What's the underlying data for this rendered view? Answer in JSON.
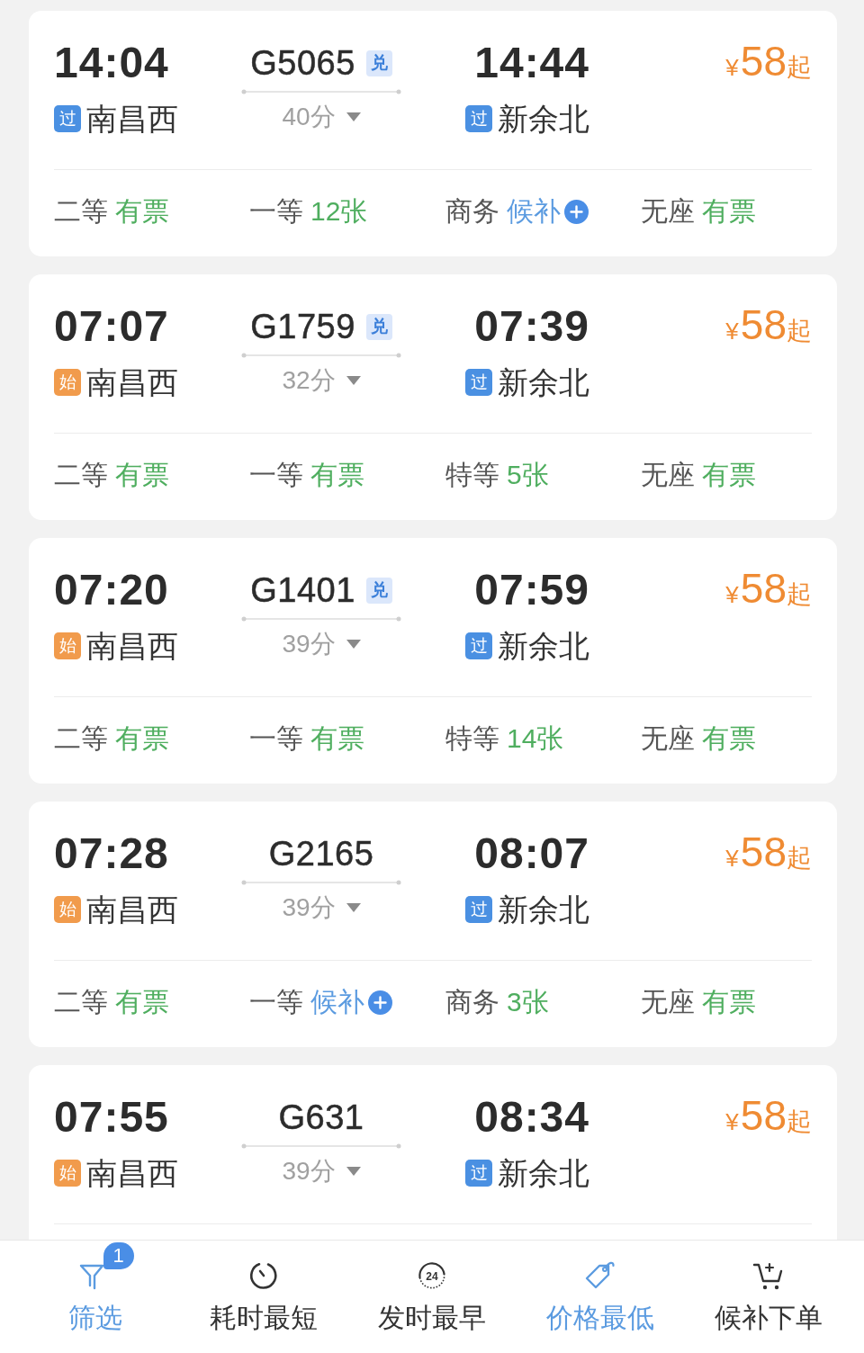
{
  "trains": [
    {
      "depart_time": "14:04",
      "from": {
        "tag": "过",
        "kind": "pass",
        "name": "南昌西"
      },
      "train_no": "G5065",
      "badge": "兑",
      "duration": "40分",
      "arrive_time": "14:44",
      "to": {
        "tag": "过",
        "kind": "pass",
        "name": "新余北"
      },
      "price": {
        "currency": "¥",
        "amount": "58",
        "suffix": "起"
      },
      "seats": [
        {
          "class": "二等",
          "status": "有票",
          "kind": "available"
        },
        {
          "class": "一等",
          "status": "12张",
          "kind": "available"
        },
        {
          "class": "商务",
          "status": "候补",
          "kind": "waitlist"
        },
        {
          "class": "无座",
          "status": "有票",
          "kind": "available"
        }
      ]
    },
    {
      "depart_time": "07:07",
      "from": {
        "tag": "始",
        "kind": "origin",
        "name": "南昌西"
      },
      "train_no": "G1759",
      "badge": "兑",
      "duration": "32分",
      "arrive_time": "07:39",
      "to": {
        "tag": "过",
        "kind": "pass",
        "name": "新余北"
      },
      "price": {
        "currency": "¥",
        "amount": "58",
        "suffix": "起"
      },
      "seats": [
        {
          "class": "二等",
          "status": "有票",
          "kind": "available"
        },
        {
          "class": "一等",
          "status": "有票",
          "kind": "available"
        },
        {
          "class": "特等",
          "status": "5张",
          "kind": "available"
        },
        {
          "class": "无座",
          "status": "有票",
          "kind": "available"
        }
      ]
    },
    {
      "depart_time": "07:20",
      "from": {
        "tag": "始",
        "kind": "origin",
        "name": "南昌西"
      },
      "train_no": "G1401",
      "badge": "兑",
      "duration": "39分",
      "arrive_time": "07:59",
      "to": {
        "tag": "过",
        "kind": "pass",
        "name": "新余北"
      },
      "price": {
        "currency": "¥",
        "amount": "58",
        "suffix": "起"
      },
      "seats": [
        {
          "class": "二等",
          "status": "有票",
          "kind": "available"
        },
        {
          "class": "一等",
          "status": "有票",
          "kind": "available"
        },
        {
          "class": "特等",
          "status": "14张",
          "kind": "available"
        },
        {
          "class": "无座",
          "status": "有票",
          "kind": "available"
        }
      ]
    },
    {
      "depart_time": "07:28",
      "from": {
        "tag": "始",
        "kind": "origin",
        "name": "南昌西"
      },
      "train_no": "G2165",
      "duration": "39分",
      "arrive_time": "08:07",
      "to": {
        "tag": "过",
        "kind": "pass",
        "name": "新余北"
      },
      "price": {
        "currency": "¥",
        "amount": "58",
        "suffix": "起"
      },
      "seats": [
        {
          "class": "二等",
          "status": "有票",
          "kind": "available"
        },
        {
          "class": "一等",
          "status": "候补",
          "kind": "waitlist"
        },
        {
          "class": "商务",
          "status": "3张",
          "kind": "available"
        },
        {
          "class": "无座",
          "status": "有票",
          "kind": "available"
        }
      ]
    },
    {
      "depart_time": "07:55",
      "from": {
        "tag": "始",
        "kind": "origin",
        "name": "南昌西"
      },
      "train_no": "G631",
      "duration": "39分",
      "arrive_time": "08:34",
      "to": {
        "tag": "过",
        "kind": "pass",
        "name": "新余北"
      },
      "price": {
        "currency": "¥",
        "amount": "58",
        "suffix": "起"
      }
    }
  ],
  "bottom_bar": {
    "items": [
      {
        "kind": "filter",
        "label": "筛选",
        "selected": true,
        "badge": "1"
      },
      {
        "kind": "duration",
        "label": "耗时最短",
        "selected": false
      },
      {
        "kind": "departure",
        "label": "发时最早",
        "selected": false,
        "icon_text": "24"
      },
      {
        "kind": "price",
        "label": "价格最低",
        "selected": true
      },
      {
        "kind": "waitlist",
        "label": "候补下单",
        "selected": false
      }
    ]
  }
}
